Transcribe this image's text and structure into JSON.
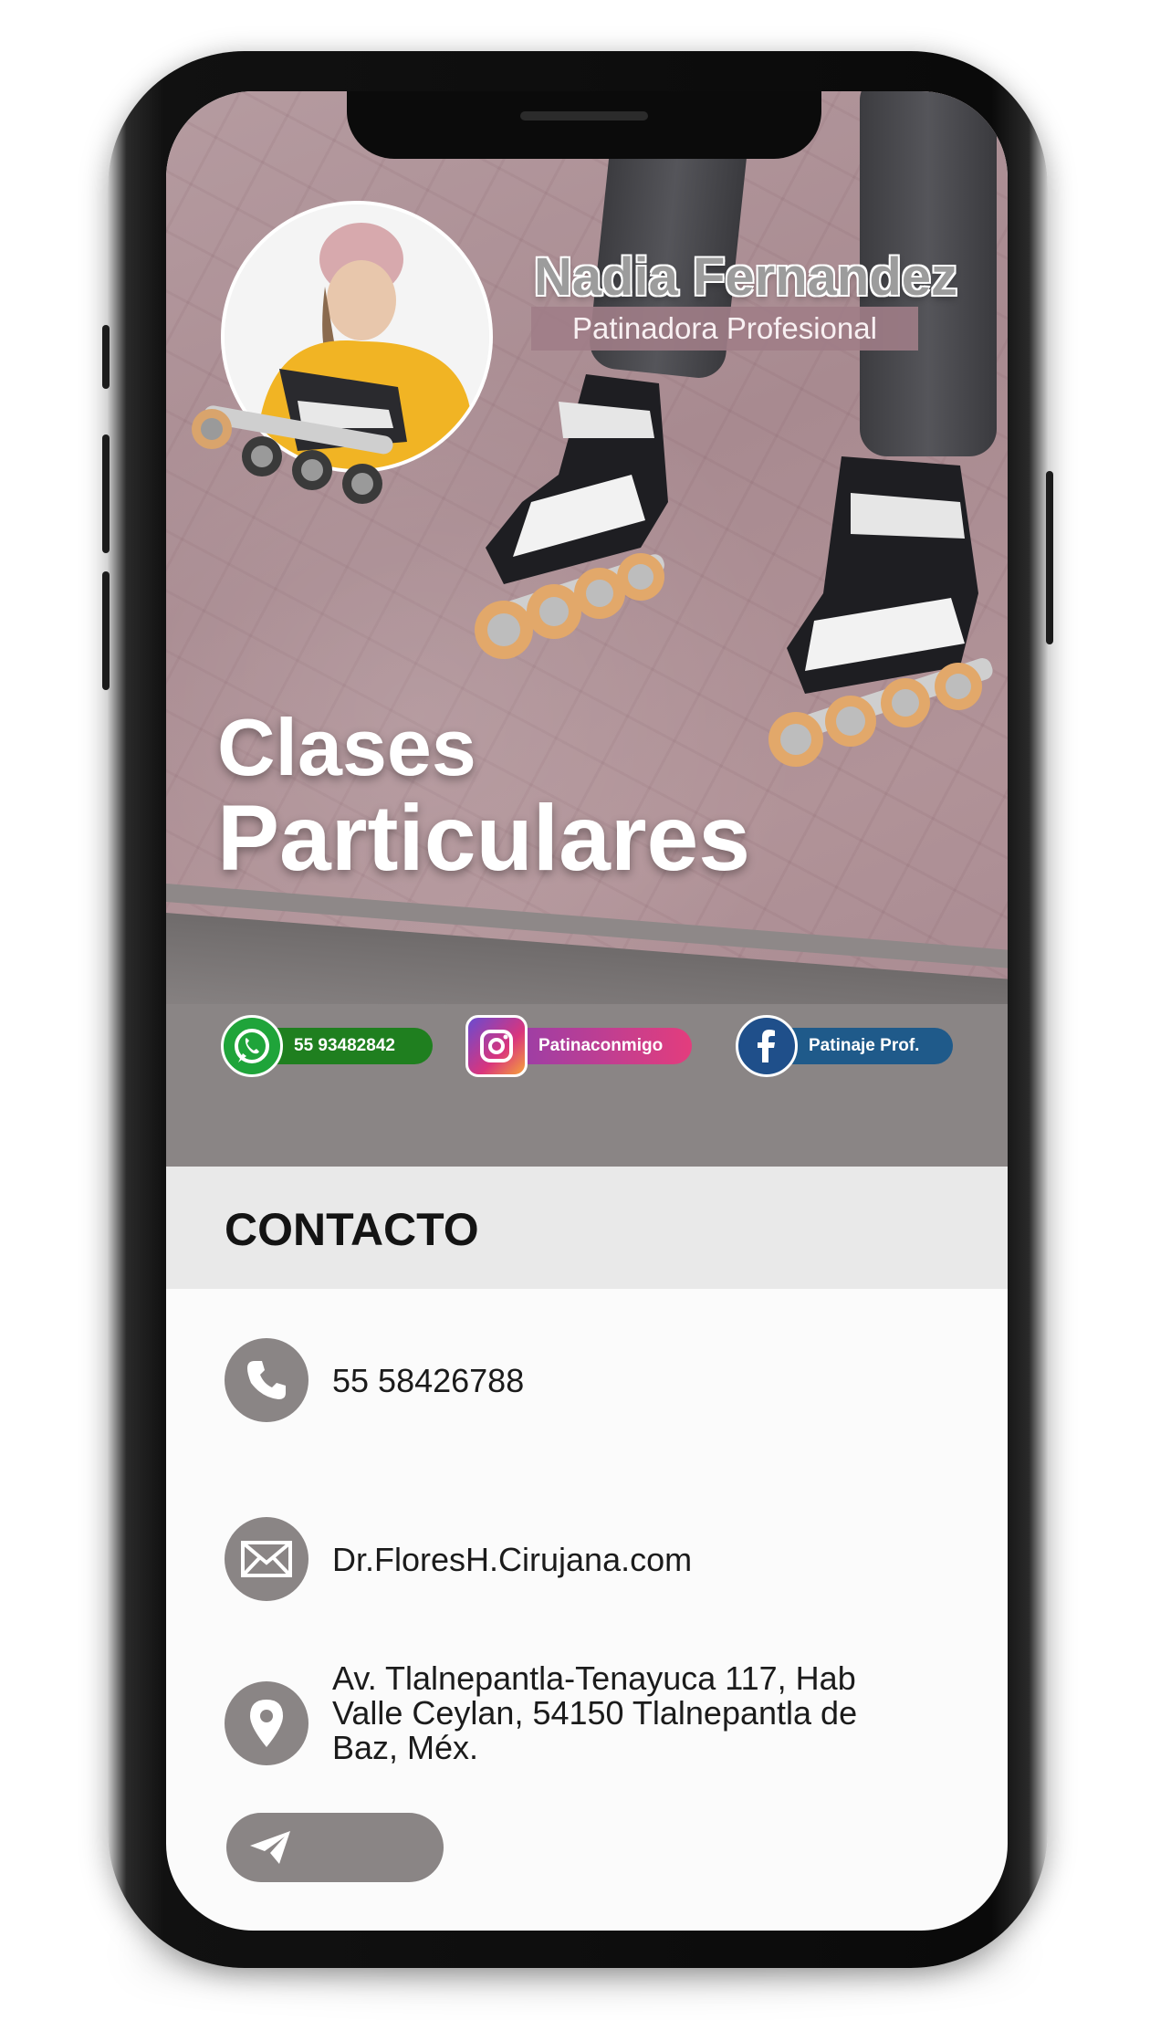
{
  "profile": {
    "name": "Nadia Fernandez",
    "role": "Patinadora Profesional"
  },
  "hero": {
    "headline_line1": "Clases",
    "headline_line2": "Particulares"
  },
  "social": {
    "whatsapp": {
      "label": "55 93482842",
      "icon": "whatsapp-icon",
      "color": "#1f7f1f"
    },
    "instagram": {
      "label": "Patinaconmigo",
      "icon": "instagram-icon",
      "color": "#c03c9a"
    },
    "facebook": {
      "label": "Patinaje Prof.",
      "icon": "facebook-icon",
      "color": "#1f4f8a"
    }
  },
  "contact": {
    "title": "CONTACTO",
    "phone": "55 58426788",
    "email": "Dr.FloresH.Cirujana.com",
    "address_line1": "Av. Tlalnepantla-Tenayuca 117, Hab",
    "address_line2": "Valle Ceylan, 54150 Tlalnepantla de",
    "address_line3": "Baz, Méx.",
    "icons": [
      "phone-icon",
      "mail-icon",
      "location-pin-icon",
      "send-icon"
    ]
  },
  "colors": {
    "accent_gray": "#8a8585",
    "hero_pink": "#a88a90",
    "header_band": "#e9e9e9"
  }
}
